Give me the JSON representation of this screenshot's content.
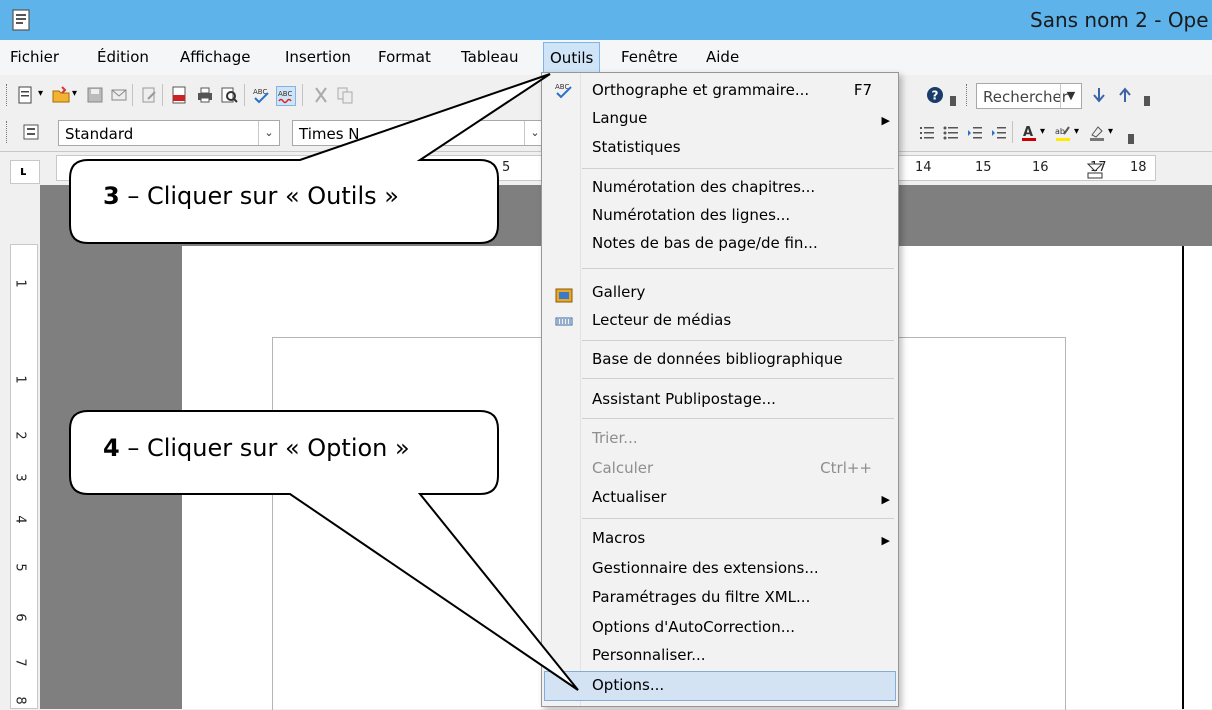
{
  "window": {
    "title": "Sans nom 2 - Ope"
  },
  "menubar": {
    "items": [
      "Fichier",
      "Édition",
      "Affichage",
      "Insertion",
      "Format",
      "Tableau",
      "Outils",
      "Fenêtre",
      "Aide"
    ]
  },
  "toolbar": {
    "find_value": "Rechercher",
    "style_value": "Standard",
    "font_value": "Times N"
  },
  "ruler": {
    "h_numbers": [
      "5",
      "14",
      "15",
      "16",
      "17",
      "18"
    ],
    "v_numbers": [
      "1",
      "1",
      "2",
      "3",
      "4",
      "5",
      "6",
      "7",
      "8"
    ]
  },
  "dropdown": {
    "items": [
      {
        "label": "Orthographe et grammaire...",
        "shortcut": "F7"
      },
      {
        "label": "Langue"
      },
      {
        "label": "Statistiques"
      },
      {
        "label": "Numérotation des chapitres..."
      },
      {
        "label": "Numérotation des lignes..."
      },
      {
        "label": "Notes de bas de page/de fin..."
      },
      {
        "label": "Gallery"
      },
      {
        "label": "Lecteur de médias"
      },
      {
        "label": "Base de données bibliographique"
      },
      {
        "label": "Assistant Publipostage..."
      },
      {
        "label": "Trier..."
      },
      {
        "label": "Calculer",
        "shortcut": "Ctrl++"
      },
      {
        "label": "Actualiser"
      },
      {
        "label": "Macros"
      },
      {
        "label": "Gestionnaire des extensions..."
      },
      {
        "label": "Paramétrages du filtre XML..."
      },
      {
        "label": "Options d'AutoCorrection..."
      },
      {
        "label": "Personnaliser..."
      },
      {
        "label": "Options..."
      }
    ]
  },
  "callouts": {
    "step3": {
      "number": "3",
      "text": " – Cliquer sur « Outils »"
    },
    "step4": {
      "number": "4",
      "text": " – Cliquer sur « Option »"
    }
  },
  "colors": {
    "titlebar": "#5db3ea",
    "highlight": "#d3e3f3",
    "document_bg": "#7f7f7f"
  }
}
